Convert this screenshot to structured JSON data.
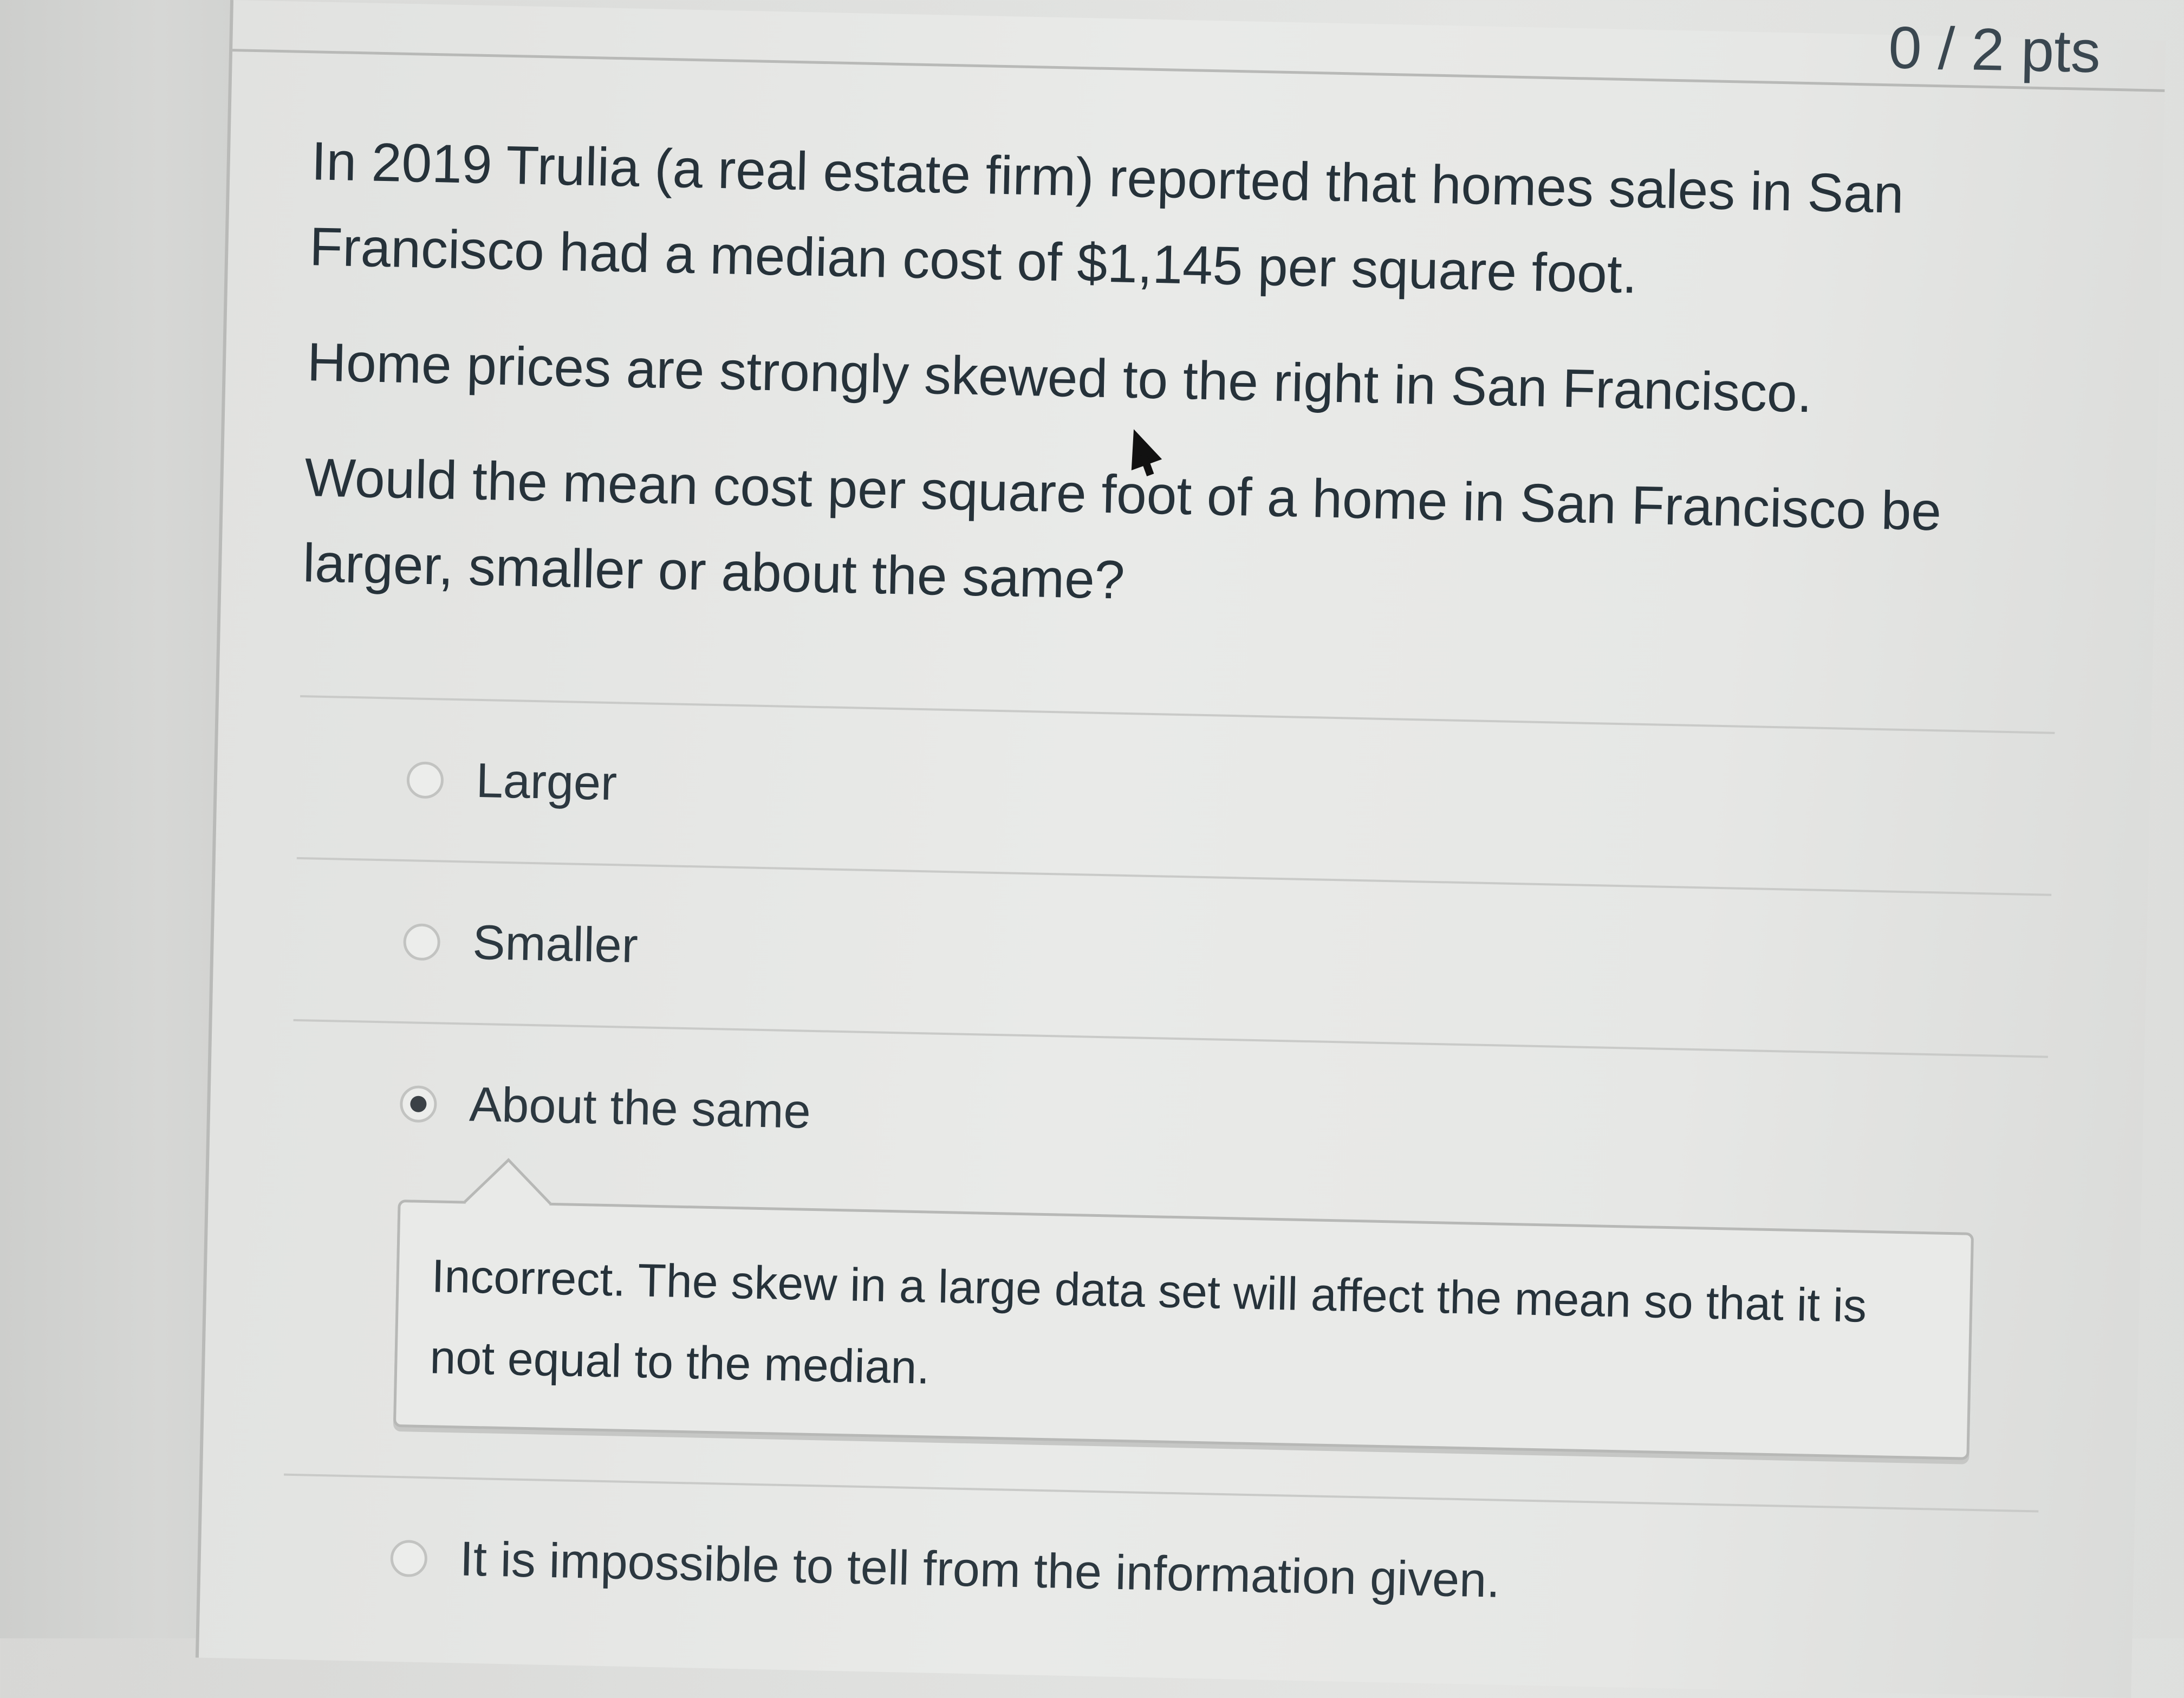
{
  "header": {
    "points": "0 / 2 pts"
  },
  "question": {
    "paragraphs": [
      "In 2019 Trulia (a real estate firm) reported that homes sales in San Francisco had a median cost of $1,145 per square foot.",
      "Home prices are strongly skewed to the right in San Francisco.",
      "Would the mean cost per square foot of a home in San Francisco be larger, smaller or about the same?"
    ]
  },
  "answers": [
    {
      "label": "Larger",
      "selected": false
    },
    {
      "label": "Smaller",
      "selected": false
    },
    {
      "label": "About the same",
      "selected": true
    },
    {
      "label": "It is impossible to tell from the information given.",
      "selected": false
    }
  ],
  "feedback": {
    "text": "Incorrect. The skew in a large data set will affect the mean so that it is not equal to the median."
  }
}
